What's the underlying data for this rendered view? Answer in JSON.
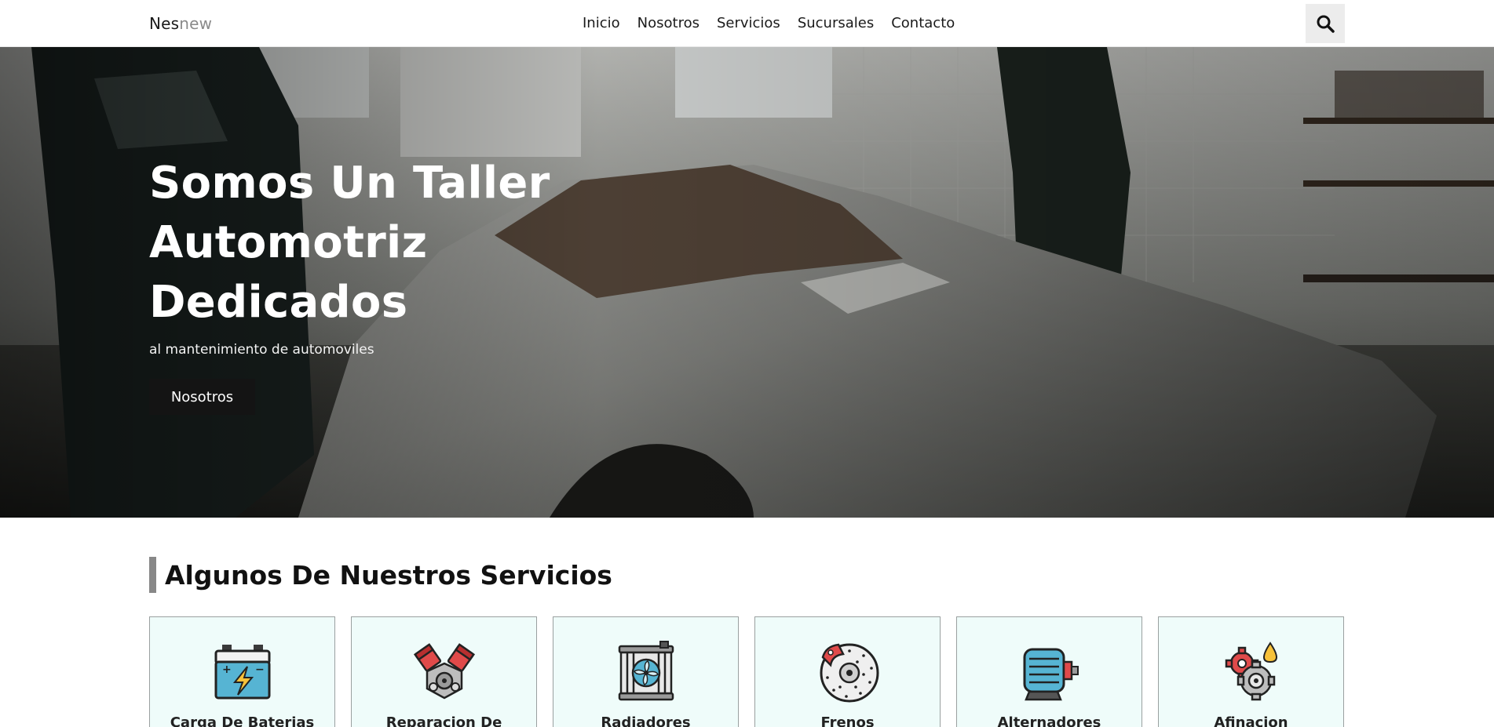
{
  "header": {
    "logo_part1": "Nes",
    "logo_part2": "new",
    "nav": [
      "Inicio",
      "Nosotros",
      "Servicios",
      "Sucursales",
      "Contacto"
    ]
  },
  "hero": {
    "title": "Somos Un Taller Automotriz Dedicados",
    "subtitle": "al mantenimiento de automoviles",
    "button": "Nosotros"
  },
  "services": {
    "title": "Algunos De Nuestros Servicios",
    "items": [
      {
        "label": "Carga De Baterias",
        "icon": "battery-icon"
      },
      {
        "label": "Reparacion De",
        "icon": "engine-icon"
      },
      {
        "label": "Radiadores",
        "icon": "radiator-icon"
      },
      {
        "label": "Frenos",
        "icon": "brake-disc-icon"
      },
      {
        "label": "Alternadores",
        "icon": "alternator-icon"
      },
      {
        "label": "Afinacion",
        "icon": "gear-oil-icon"
      }
    ]
  }
}
